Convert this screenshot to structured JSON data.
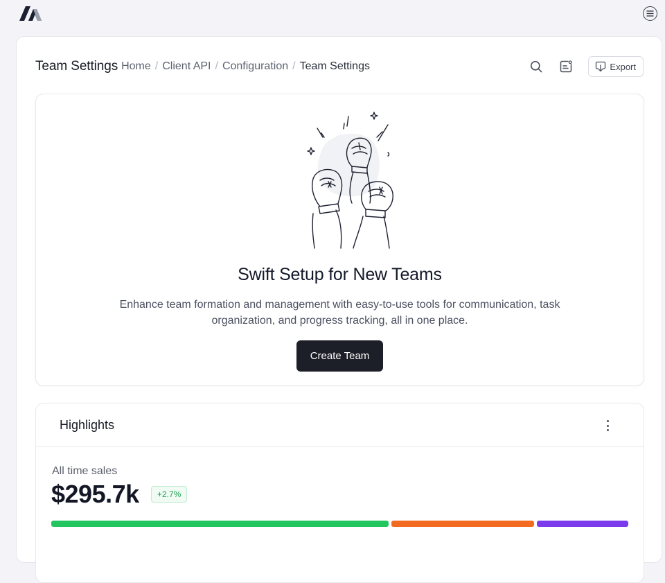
{
  "app": {
    "logo_icon": "logo-mark-icon",
    "menu_icon": "menu-icon"
  },
  "header": {
    "title": "Team Settings",
    "breadcrumbs": [
      {
        "label": "Home"
      },
      {
        "label": "Client API"
      },
      {
        "label": "Configuration"
      },
      {
        "label": "Team Settings"
      }
    ],
    "separator": "/",
    "actions": {
      "search_icon": "search-icon",
      "notes_icon": "sticky-note-icon",
      "export_label": "Export"
    }
  },
  "hero": {
    "title": "Swift Setup for New Teams",
    "description": "Enhance team formation and management with easy-to-use tools for communication, task organization, and progress tracking, all in one place.",
    "cta_label": "Create Team",
    "illustration": "raised-fists-illustration"
  },
  "highlights": {
    "title": "Highlights",
    "metric_label": "All time sales",
    "metric_value": "$295.7k",
    "change_badge": "+2.7%",
    "bars": [
      {
        "share": 0.59,
        "color": "#22c55e"
      },
      {
        "share": 0.25,
        "color": "#f26b21"
      },
      {
        "share": 0.16,
        "color": "#7c3aed"
      }
    ]
  },
  "colors": {
    "accent_dark": "#1c1f27",
    "positive": "#1e9d52",
    "background": "#f4f4f8"
  }
}
